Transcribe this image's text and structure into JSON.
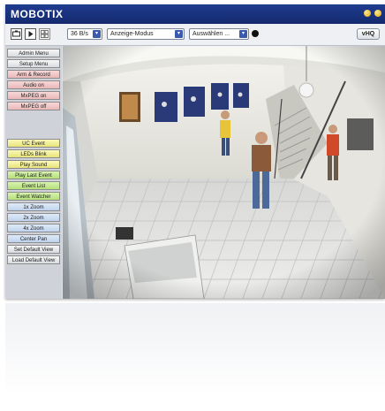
{
  "app": {
    "title": "MOBOTIX"
  },
  "toolbar": {
    "rate": "36 B/s",
    "mode": "Anzeige-Modus",
    "select": "Auswählen ...",
    "hq": "vHQ",
    "arrow_glyph": "▾"
  },
  "sidebar": {
    "items": [
      {
        "label": "Admin Menu",
        "color": "grey"
      },
      {
        "label": "Setup Menu",
        "color": "grey"
      },
      {
        "label": "Arm & Record",
        "color": "pink"
      },
      {
        "label": "Audio on",
        "color": "pink"
      },
      {
        "label": "MxPEG on",
        "color": "pink"
      },
      {
        "label": "MxPEG off",
        "color": "pink"
      },
      {
        "label": "UC Event",
        "color": "yellow"
      },
      {
        "label": "LEDs Blink",
        "color": "yellow"
      },
      {
        "label": "Play Sound",
        "color": "yellow"
      },
      {
        "label": "Play Last Event",
        "color": "green"
      },
      {
        "label": "Event List",
        "color": "green"
      },
      {
        "label": "Event Watcher",
        "color": "green"
      },
      {
        "label": "1x Zoom",
        "color": "blue"
      },
      {
        "label": "2x Zoom",
        "color": "blue"
      },
      {
        "label": "4x Zoom",
        "color": "blue"
      },
      {
        "label": "Center Pan",
        "color": "blue"
      },
      {
        "label": "Set Default View",
        "color": "grey"
      },
      {
        "label": "Load Default View",
        "color": "grey"
      }
    ]
  },
  "icons": {
    "toolbar": [
      "camera-icon",
      "play-icon",
      "grid-icon",
      "info-icon"
    ],
    "titlebar": [
      "help-icon",
      "settings-icon"
    ]
  }
}
